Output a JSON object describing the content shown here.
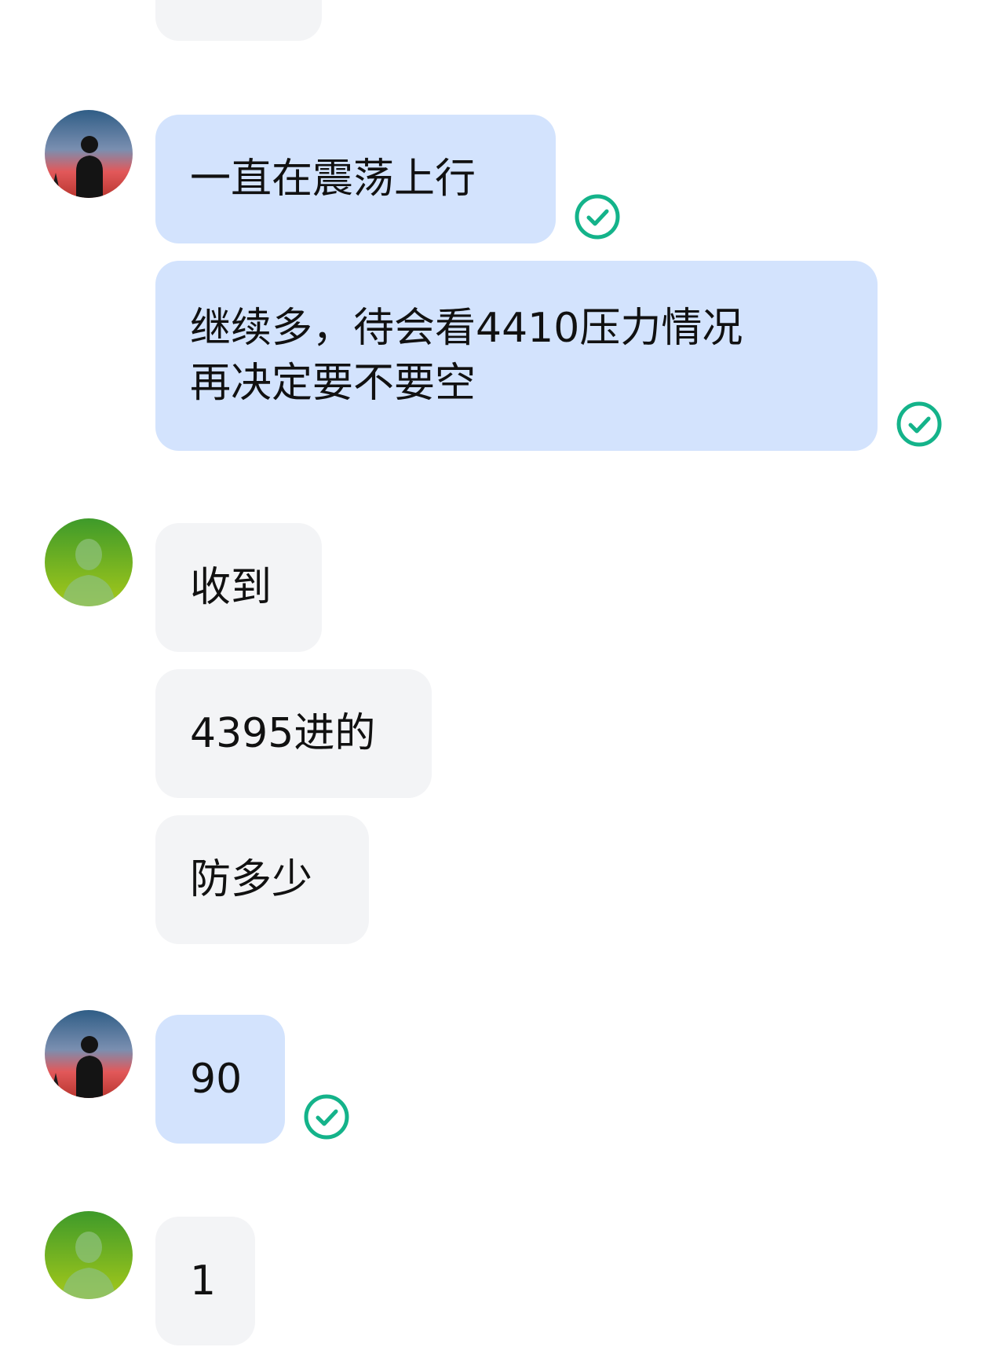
{
  "colors": {
    "self_bubble": "#d3e3fd",
    "other_bubble": "#f3f4f6",
    "read_check": "#14b38a"
  },
  "messages": [
    {
      "sender": "other",
      "text": ""
    },
    {
      "sender": "self",
      "avatar": "sunset-silhouette-avatar",
      "text": "一直在震荡上行",
      "status": "read-check-icon"
    },
    {
      "sender": "self",
      "lines": [
        "继续多，待会看4410压力情况",
        "再决定要不要空"
      ],
      "status": "read-check-icon"
    },
    {
      "sender": "other",
      "avatar": "default-person-avatar",
      "text": "收到"
    },
    {
      "sender": "other",
      "text": "4395进的"
    },
    {
      "sender": "other",
      "text": "防多少"
    },
    {
      "sender": "self",
      "avatar": "sunset-silhouette-avatar",
      "text": "90",
      "status": "read-check-icon"
    },
    {
      "sender": "other",
      "avatar": "default-person-avatar",
      "text": "1"
    }
  ]
}
